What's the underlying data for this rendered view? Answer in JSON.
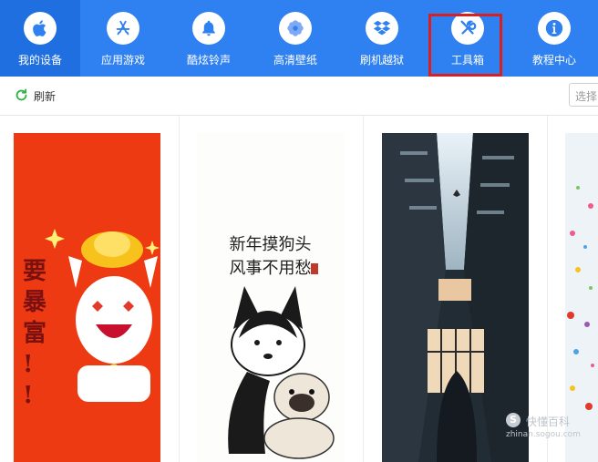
{
  "nav": {
    "items": [
      {
        "label": "我的设备",
        "icon": "apple-icon"
      },
      {
        "label": "应用游戏",
        "icon": "app-store-icon"
      },
      {
        "label": "酷炫铃声",
        "icon": "bell-icon"
      },
      {
        "label": "高清壁纸",
        "icon": "flower-icon"
      },
      {
        "label": "刷机越狱",
        "icon": "dropbox-icon"
      },
      {
        "label": "工具箱",
        "icon": "tools-icon"
      },
      {
        "label": "教程中心",
        "icon": "info-icon"
      }
    ],
    "active_index": 0,
    "highlighted_index": 5,
    "highlight_color": "#d82020",
    "bg_color": "#2f80f0"
  },
  "toolbar": {
    "refresh_label": "刷新",
    "select_placeholder": "选择"
  },
  "wallpapers": [
    {
      "name": "rich-wallpaper",
      "text": "要暴富!!"
    },
    {
      "name": "husky-pug-wallpaper",
      "title_line1": "新年摸狗头",
      "title_line2": "风事不用愁"
    },
    {
      "name": "building-sky-wallpaper"
    },
    {
      "name": "confetti-wallpaper"
    }
  ],
  "watermark": {
    "text": "快懂百科",
    "url": "zhinan.sogou.com"
  }
}
